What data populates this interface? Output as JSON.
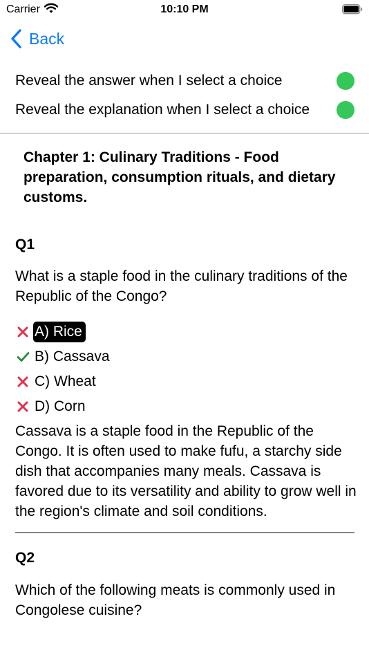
{
  "status_bar": {
    "carrier": "Carrier",
    "time": "10:10 PM"
  },
  "nav": {
    "back_label": "Back"
  },
  "settings": {
    "reveal_answer": {
      "label": "Reveal the answer when I select a choice",
      "on": true
    },
    "reveal_explanation": {
      "label": "Reveal the explanation when I select a choice",
      "on": true
    }
  },
  "chapter": {
    "title": "Chapter 1: Culinary Traditions - Food preparation, consumption rituals, and dietary customs."
  },
  "questions": [
    {
      "number": "Q1",
      "text": "What is a staple food in the culinary traditions of the Republic of the Congo?",
      "choices": [
        {
          "label": "A) Rice",
          "mark": "x-icon",
          "selected": true
        },
        {
          "label": "B) Cassava",
          "mark": "check-icon",
          "selected": false
        },
        {
          "label": "C) Wheat",
          "mark": "x-icon",
          "selected": false
        },
        {
          "label": "D) Corn",
          "mark": "x-icon",
          "selected": false
        }
      ],
      "explanation": "Cassava is a staple food in the Republic of the Congo. It is often used to make fufu, a starchy side dish that accompanies many meals. Cassava is favored due to its versatility and ability to grow well in the region's climate and soil conditions."
    },
    {
      "number": "Q2",
      "text": "Which of the following meats is commonly used in Congolese cuisine?"
    }
  ],
  "colors": {
    "accent": "#0a7aff",
    "toggle_on": "#34c759",
    "wrong": "#e0314b",
    "correct": "#2e8b3a"
  }
}
